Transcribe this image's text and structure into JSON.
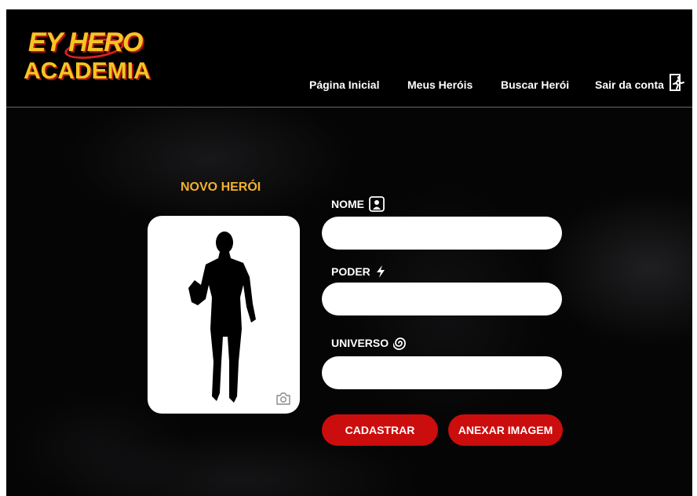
{
  "app": {
    "logo_line1": "EY HERO",
    "logo_line2": "ACADEMIA"
  },
  "nav": {
    "home": "Página Inicial",
    "my_heroes": "Meus Heróis",
    "search_hero": "Buscar Herói",
    "logout": "Sair da conta",
    "logout_icon": "exit-door-icon"
  },
  "form": {
    "title": "NOVO HERÓI",
    "fields": [
      {
        "label": "NOME",
        "icon": "person-badge-icon",
        "value": "",
        "placeholder": ""
      },
      {
        "label": "PODER",
        "icon": "lightning-icon",
        "value": "",
        "placeholder": ""
      },
      {
        "label": "UNIVERSO",
        "icon": "galaxy-icon",
        "value": "",
        "placeholder": ""
      }
    ],
    "submit_label": "CADASTRAR",
    "attach_label": "ANEXAR IMAGEM",
    "image_placeholder_icon": "hero-silhouette-icon",
    "camera_icon": "camera-icon"
  },
  "colors": {
    "background": "#050505",
    "accent_gold": "#f2b12d",
    "button_red": "#cc0d0d",
    "text": "#ffffff"
  }
}
